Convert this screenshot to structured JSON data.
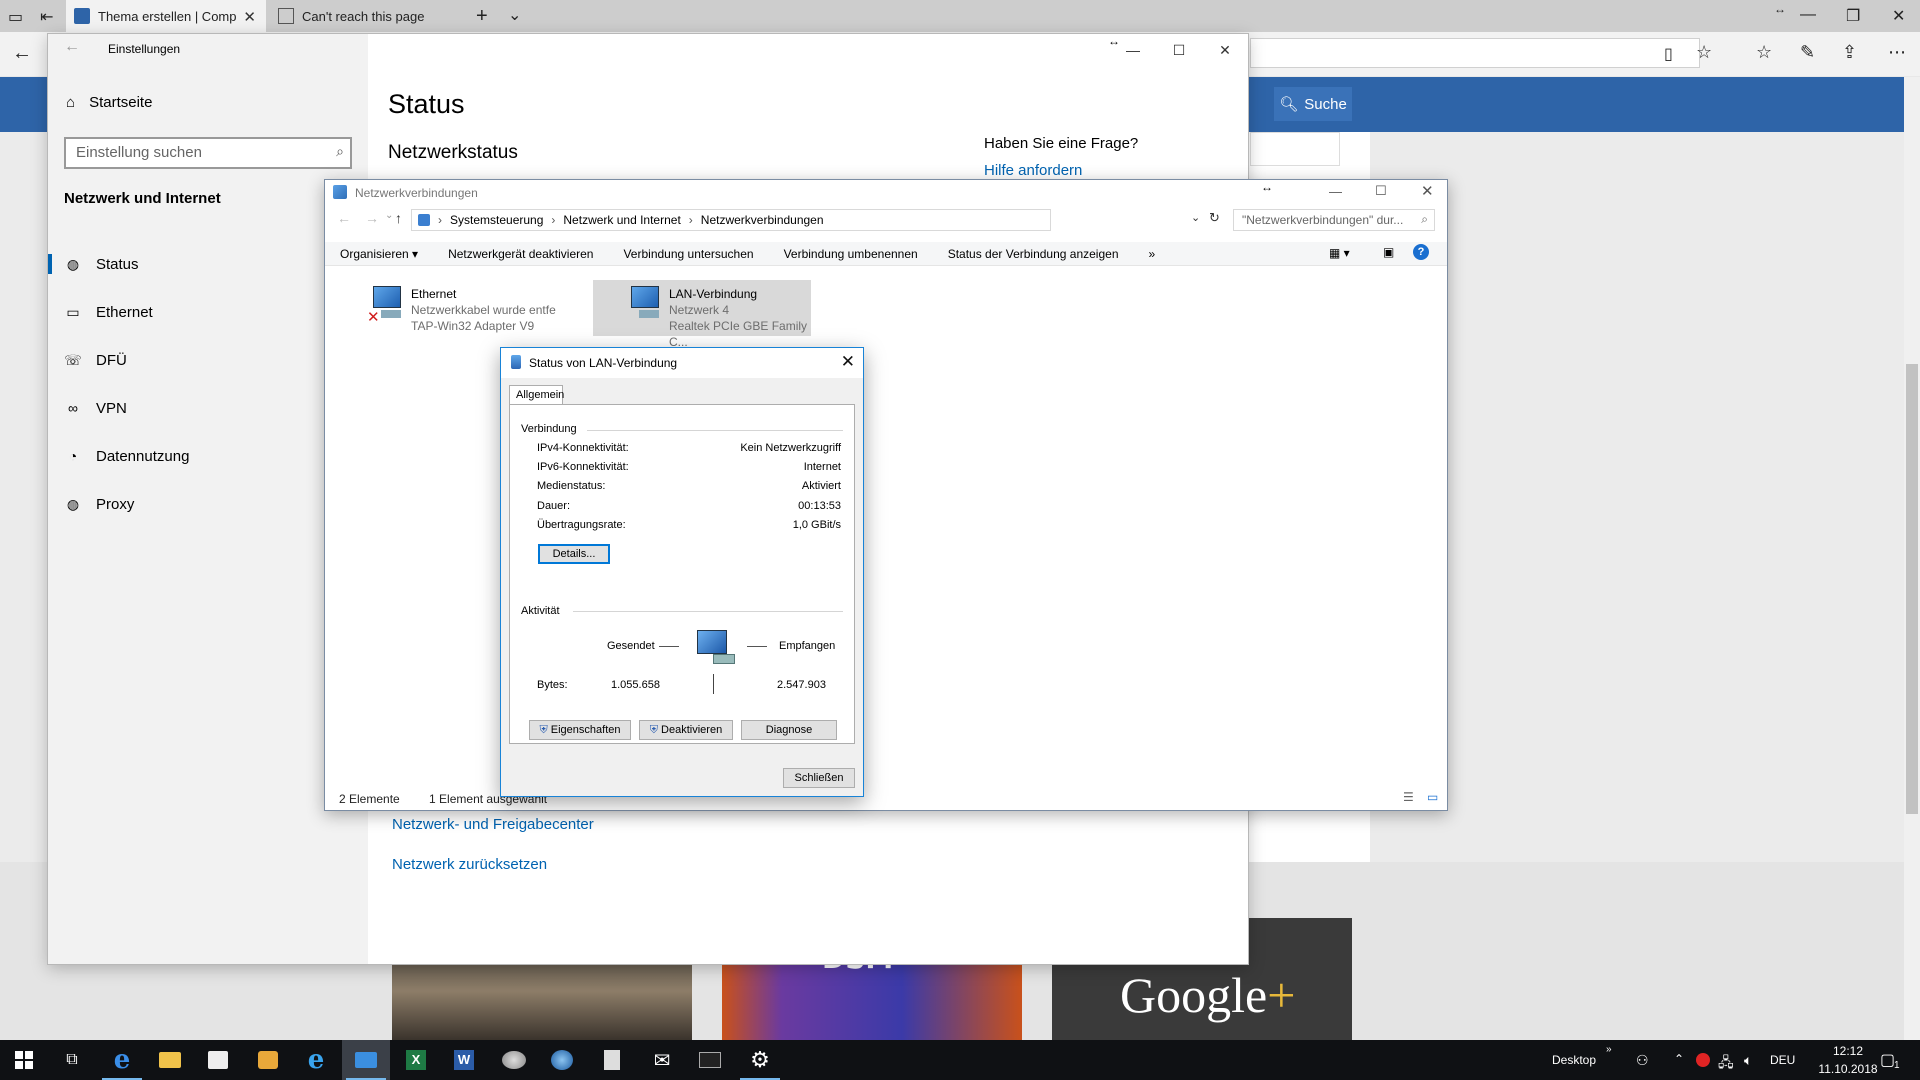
{
  "browser": {
    "tabs": [
      {
        "title": "Thema erstellen | Comp"
      },
      {
        "title": "Can't reach this page"
      }
    ],
    "new_tab": "+",
    "tab_menu": "⌄",
    "back": "←",
    "site_search_label": "Suche"
  },
  "settings": {
    "window_title": "Einstellungen",
    "home": "Startseite",
    "search_placeholder": "Einstellung suchen",
    "category": "Netzwerk und Internet",
    "nav": [
      {
        "label": "Status",
        "icon": "globe-icon"
      },
      {
        "label": "Ethernet",
        "icon": "monitor-icon"
      },
      {
        "label": "DFÜ",
        "icon": "phone-icon"
      },
      {
        "label": "VPN",
        "icon": "vpn-icon"
      },
      {
        "label": "Datennutzung",
        "icon": "pie-chart-icon"
      },
      {
        "label": "Proxy",
        "icon": "globe-icon"
      }
    ],
    "heading": "Status",
    "subheading": "Netzwerkstatus",
    "question": "Haben Sie eine Frage?",
    "help_link": "Hilfe anfordern",
    "links": [
      "Netzwerk- und Freigabecenter",
      "Netzwerk zurücksetzen"
    ]
  },
  "explorer": {
    "title": "Netzwerkverbindungen",
    "breadcrumb": [
      "Systemsteuerung",
      "Netzwerk und Internet",
      "Netzwerkverbindungen"
    ],
    "search_placeholder": "\"Netzwerkverbindungen\" dur...",
    "commands": [
      "Organisieren ▾",
      "Netzwerkgerät deaktivieren",
      "Verbindung untersuchen",
      "Verbindung umbenennen",
      "Status der Verbindung anzeigen",
      "»"
    ],
    "items": [
      {
        "name": "Ethernet",
        "line2": "Netzwerkkabel wurde entfe",
        "line3": "TAP-Win32 Adapter V9"
      },
      {
        "name": "LAN-Verbindung",
        "line2": "Netzwerk 4",
        "line3": "Realtek PCIe GBE Family C..."
      }
    ],
    "status_count": "2 Elemente",
    "status_selected": "1 Element ausgewählt"
  },
  "dialog": {
    "title": "Status von LAN-Verbindung",
    "tab": "Allgemein",
    "group_connection": "Verbindung",
    "rows": [
      {
        "label": "IPv4-Konnektivität:",
        "value": "Kein Netzwerkzugriff"
      },
      {
        "label": "IPv6-Konnektivität:",
        "value": "Internet"
      },
      {
        "label": "Medienstatus:",
        "value": "Aktiviert"
      },
      {
        "label": "Dauer:",
        "value": "00:13:53"
      },
      {
        "label": "Übertragungsrate:",
        "value": "1,0 GBit/s"
      }
    ],
    "details_button": "Details...",
    "group_activity": "Aktivität",
    "sent_label": "Gesendet",
    "received_label": "Empfangen",
    "bytes_label": "Bytes:",
    "bytes_sent": "1.055.658",
    "bytes_received": "2.547.903",
    "properties_button": "Eigenschaften",
    "disable_button": "Deaktivieren",
    "diagnose_button": "Diagnose",
    "close_button": "Schließen"
  },
  "taskbar": {
    "desktop_label": "Desktop",
    "language": "DEU",
    "time": "12:12",
    "date": "11.10.2018",
    "notification_count": "1"
  },
  "colors": {
    "accent": "#0063b1",
    "site_bar": "#2e64a8",
    "taskbar": "#0f1114",
    "dialog_border": "#1883d7"
  }
}
